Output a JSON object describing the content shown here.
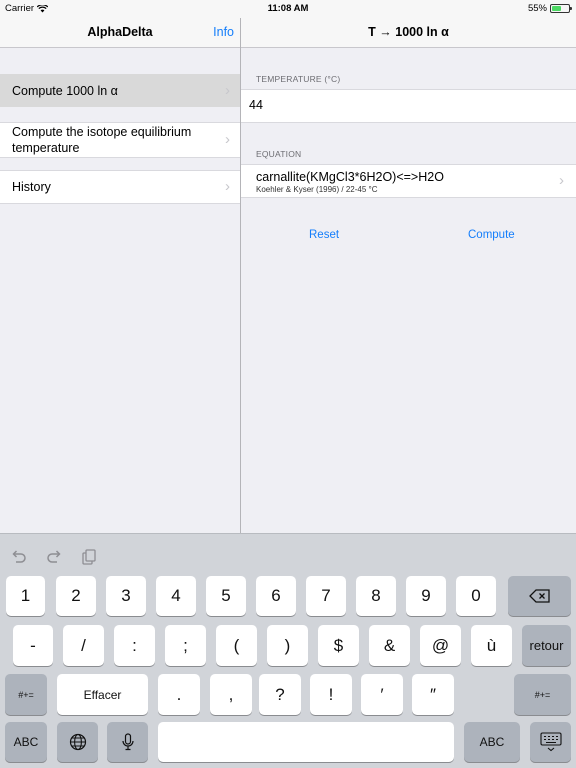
{
  "status": {
    "carrier": "Carrier",
    "time": "11:08 AM",
    "battery": "55%",
    "battery_level": 0.55
  },
  "master_nav": {
    "title": "AlphaDelta",
    "info": "Info"
  },
  "detail_nav": {
    "title": "T → 1000 ln α"
  },
  "menu": {
    "items": [
      {
        "label": "Compute 1000 ln α"
      },
      {
        "label": "Compute the isotope equilibrium temperature"
      },
      {
        "label": "History"
      }
    ]
  },
  "form": {
    "temperature_label": "TEMPERATURE (°C)",
    "temperature_value": "44",
    "equation_label": "EQUATION",
    "equation_name": "carnallite(KMgCl3*6H2O)<=>H2O",
    "equation_source": "Koehler & Kyser (1996) / 22-45 °C",
    "reset": "Reset",
    "compute": "Compute"
  },
  "keyboard": {
    "icons": [
      "undo-icon",
      "redo-icon",
      "paste-icon",
      "backspace-icon",
      "globe-icon",
      "microphone-icon",
      "keyboard-dismiss-icon"
    ],
    "row1": [
      "1",
      "2",
      "3",
      "4",
      "5",
      "6",
      "7",
      "8",
      "9",
      "0"
    ],
    "row2": [
      "-",
      "/",
      ":",
      ";",
      "(",
      ")",
      "$",
      "&",
      "@",
      "ù"
    ],
    "return": "retour",
    "row3_left": "#+=",
    "effacer": "Effacer",
    "row3": [
      ".",
      ",",
      "?",
      "!",
      "′",
      "″"
    ],
    "row3_right": "#+=",
    "abc_left": "ABC",
    "abc_right": "ABC"
  }
}
